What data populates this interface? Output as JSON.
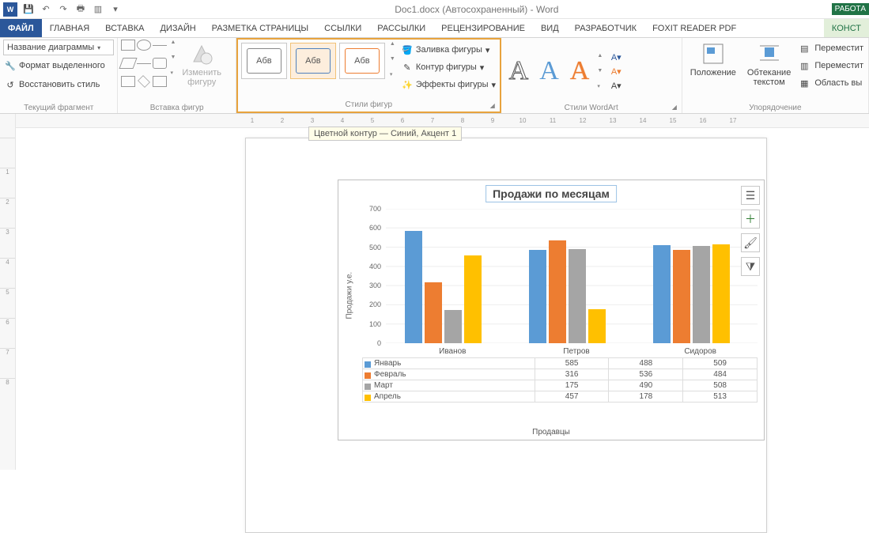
{
  "title": "Doc1.docx (Автосохраненный) - Word",
  "context_tab": "РАБОТА",
  "context_sub": "КОНСТ",
  "tabs": {
    "file": "ФАЙЛ",
    "t0": "ГЛАВНАЯ",
    "t1": "ВСТАВКА",
    "t2": "ДИЗАЙН",
    "t3": "РАЗМЕТКА СТРАНИЦЫ",
    "t4": "ССЫЛКИ",
    "t5": "РАССЫЛКИ",
    "t6": "РЕЦЕНЗИРОВАНИЕ",
    "t7": "ВИД",
    "t8": "РАЗРАБОТЧИК",
    "t9": "FOXIT READER PDF"
  },
  "groups": {
    "current_fragment": {
      "label": "Текущий фрагмент",
      "chart_element": "Название диаграммы",
      "format_sel": "Формат выделенного",
      "reset": "Восстановить стиль"
    },
    "insert_shapes": {
      "label": "Вставка фигур",
      "change_shape": "Изменить\nфигуру"
    },
    "shape_styles": {
      "label": "Стили фигур",
      "sample_text": "Абв",
      "fill": "Заливка фигуры",
      "outline": "Контур фигуры",
      "effects": "Эффекты фигуры"
    },
    "wordart": {
      "label": "Стили WordArt"
    },
    "arrange": {
      "label": "Упорядочение",
      "position": "Положение",
      "wrap": "Обтекание\nтекстом",
      "move1": "Переместит",
      "move2": "Переместит",
      "sel_pane": "Область вы"
    }
  },
  "tooltip": "Цветной контур — Синий, Акцент 1",
  "ruler_cm": [
    "1",
    "2",
    "3",
    "4",
    "5",
    "6",
    "7",
    "8",
    "9",
    "10",
    "11",
    "12",
    "13",
    "14",
    "15",
    "16",
    "17"
  ],
  "vruler": [
    "",
    "1",
    "2",
    "3",
    "4",
    "5",
    "6",
    "7",
    "8"
  ],
  "chart_title": "Продажи по месяцам",
  "chart_data": {
    "type": "bar",
    "title": "Продажи по месяцам",
    "ylabel": "Продажи у.е.",
    "xlabel": "Продавцы",
    "ylim": [
      0,
      700
    ],
    "yticks": [
      0,
      100,
      200,
      300,
      400,
      500,
      600,
      700
    ],
    "categories": [
      "Иванов",
      "Петров",
      "Сидоров"
    ],
    "series": [
      {
        "name": "Январь",
        "color": "#5b9bd5",
        "values": [
          585,
          488,
          509
        ]
      },
      {
        "name": "Февраль",
        "color": "#ed7d31",
        "values": [
          316,
          536,
          484
        ]
      },
      {
        "name": "Март",
        "color": "#a5a5a5",
        "values": [
          175,
          490,
          508
        ]
      },
      {
        "name": "Апрель",
        "color": "#ffc000",
        "values": [
          457,
          178,
          513
        ]
      }
    ]
  }
}
